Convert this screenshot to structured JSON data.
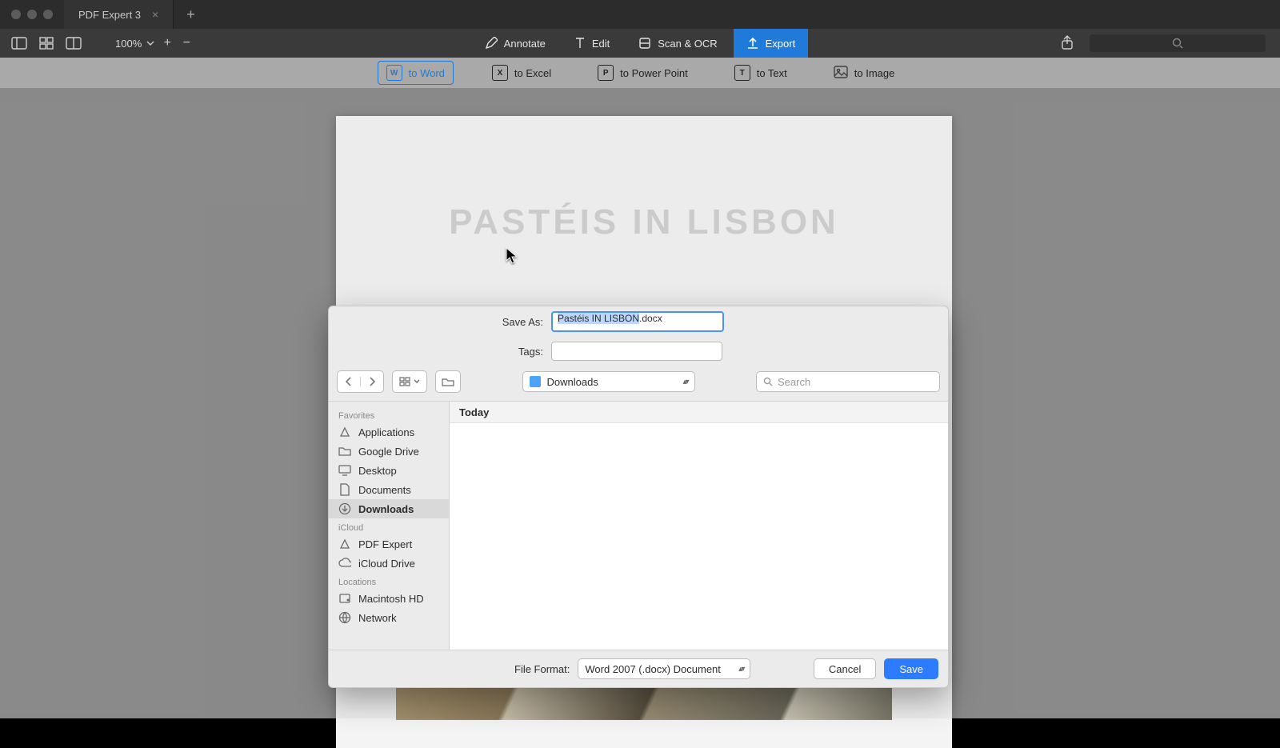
{
  "tab": {
    "title": "PDF Expert 3"
  },
  "toolbar": {
    "zoom": "100%",
    "modes": {
      "annotate": "Annotate",
      "edit": "Edit",
      "scan": "Scan & OCR",
      "export": "Export"
    }
  },
  "export_bar": {
    "word": "to Word",
    "excel": "to Excel",
    "ppt": "to Power Point",
    "text": "to Text",
    "image": "to Image"
  },
  "doc": {
    "title": "PASTÉIS IN LISBON"
  },
  "dialog": {
    "labels": {
      "save_as": "Save As:",
      "tags": "Tags:",
      "file_format": "File Format:"
    },
    "save_as": {
      "selected": "Pastéis IN LISBON",
      "suffix": ".docx"
    },
    "tags_value": "",
    "location_name": "Downloads",
    "search_placeholder": "Search",
    "column_header": "Today",
    "file_format": "Word 2007 (.docx) Document",
    "buttons": {
      "cancel": "Cancel",
      "save": "Save"
    },
    "sidebar": {
      "favorites_label": "Favorites",
      "favorites": [
        "Applications",
        "Google Drive",
        "Desktop",
        "Documents",
        "Downloads"
      ],
      "favorites_selected": "Downloads",
      "icloud_label": "iCloud",
      "icloud": [
        "PDF Expert",
        "iCloud Drive"
      ],
      "locations_label": "Locations",
      "locations": [
        "Macintosh HD",
        "Network"
      ]
    }
  }
}
